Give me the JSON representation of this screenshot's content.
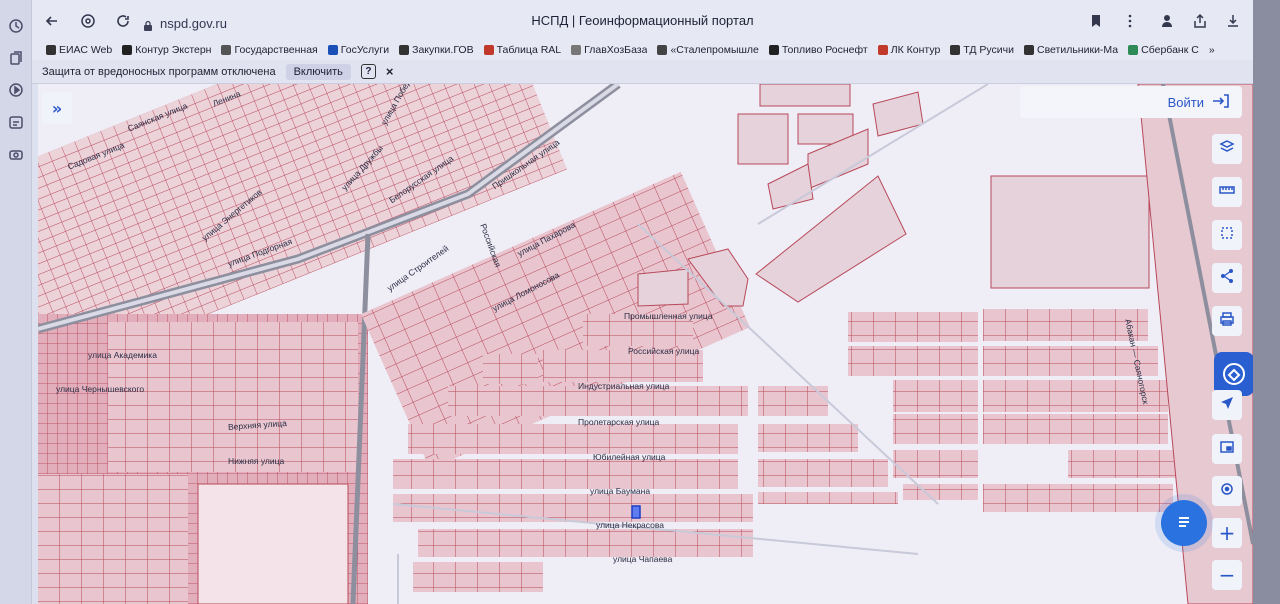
{
  "browser": {
    "url": "nspd.gov.ru",
    "title": "НСПД | Геоинформационный портал",
    "bookmarks": [
      {
        "label": "ЕИАС Web",
        "color": "#333"
      },
      {
        "label": "Контур Экстерн",
        "color": "#222"
      },
      {
        "label": "Государственная",
        "color": "#555"
      },
      {
        "label": "ГосУслуги",
        "color": "#1b4fb8"
      },
      {
        "label": "Закупки.ГОВ",
        "color": "#333"
      },
      {
        "label": "Таблица RAL",
        "color": "#c0392b"
      },
      {
        "label": "ГлавХозБаза",
        "color": "#777"
      },
      {
        "label": "«Сталепромышле",
        "color": "#444"
      },
      {
        "label": "Топливо Роснефт",
        "color": "#222"
      },
      {
        "label": "ЛК Контур",
        "color": "#c0392b"
      },
      {
        "label": "ТД Русичи",
        "color": "#333"
      },
      {
        "label": "Светильники-Ма",
        "color": "#333"
      },
      {
        "label": "Сбербанк С",
        "color": "#2e8b57"
      }
    ],
    "more_bookmarks": "»",
    "infobar": {
      "message": "Защита от вредоносных программ отключена",
      "enable_label": "Включить",
      "help": "?",
      "close": "×"
    }
  },
  "map": {
    "login_label": "Войти",
    "expand_icon": "»",
    "streets": [
      "Садовая улица",
      "Саянская улица",
      "Ленина",
      "улица Победы",
      "улица Дружбы",
      "Белорусская улица",
      "Пришкольная улица",
      "улица Энергетиков",
      "Российская",
      "улица Строителей",
      "улица Пахарова",
      "улица Ломоносова",
      "улица Подгорная",
      "улица Академика",
      "улица Чернышевского",
      "Верхняя улица",
      "Нижняя улица",
      "Промышленная улица",
      "Российская улица",
      "Индустриальная улица",
      "Пролетарская улица",
      "Юбилейная улица",
      "улица Баумана",
      "улица Некрасова",
      "улица Чапаева",
      "Абакан — Саяногорск"
    ],
    "tools": [
      "layers-icon",
      "ruler-icon",
      "select-area-icon",
      "share-icon",
      "print-icon",
      "navigate-icon",
      "screen-icon",
      "locate-icon",
      "zoom-in-icon",
      "zoom-out-icon"
    ],
    "zoom_in": "+",
    "zoom_out": "−",
    "colors": {
      "parcel_fill": "#e9c6cf",
      "parcel_stroke": "#b8485a",
      "road": "#c8c9d9",
      "highway": "#8e8f9e",
      "accent": "#2a57c8"
    }
  }
}
